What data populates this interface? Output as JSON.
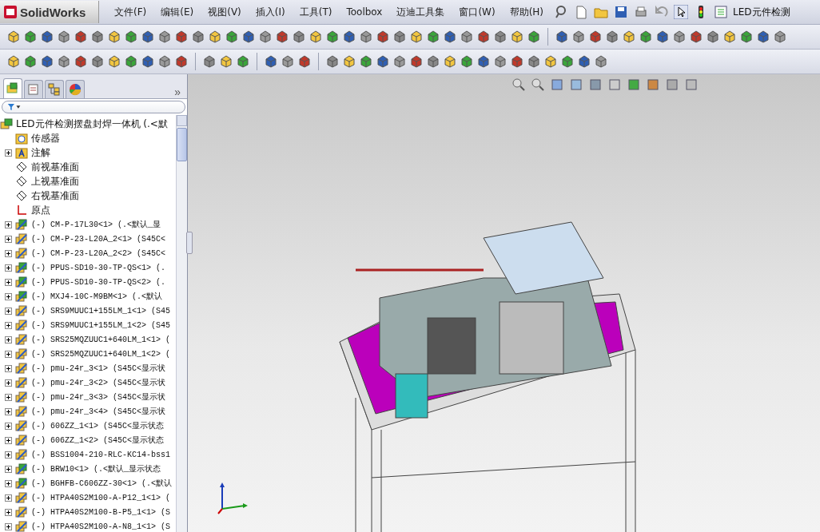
{
  "app": {
    "logo": "SolidWorks",
    "title": "LED元件检测"
  },
  "menu": [
    "文件(F)",
    "编辑(E)",
    "视图(V)",
    "插入(I)",
    "工具(T)",
    "Toolbox",
    "迈迪工具集",
    "窗口(W)",
    "帮助(H)"
  ],
  "panel_tabs": [
    {
      "selected": true
    },
    {
      "selected": false
    },
    {
      "selected": false
    },
    {
      "selected": false
    }
  ],
  "panel_collapse": "»",
  "tree": {
    "root": "LED元件检测摆盘封焊一体机 (.<默",
    "items": [
      {
        "kind": "sensor",
        "label": "传感器",
        "expandable": false
      },
      {
        "kind": "annotation",
        "label": "注解",
        "expandable": true
      },
      {
        "kind": "plane",
        "label": "前视基准面",
        "expandable": false
      },
      {
        "kind": "plane",
        "label": "上视基准面",
        "expandable": false
      },
      {
        "kind": "plane",
        "label": "右视基准面",
        "expandable": false
      },
      {
        "kind": "origin",
        "label": "原点",
        "expandable": false
      },
      {
        "kind": "assembly",
        "label": "(-) CM-P-17L30<1> (.<默认_显",
        "expandable": true
      },
      {
        "kind": "part",
        "label": "(-) CM-P-23-L20A_2<1> (S45C<",
        "expandable": true
      },
      {
        "kind": "part",
        "label": "(-) CM-P-23-L20A_2<2> (S45C<",
        "expandable": true
      },
      {
        "kind": "assembly",
        "label": "(-) PPUS-SD10-30-TP-QS<1> (.",
        "expandable": true
      },
      {
        "kind": "assembly",
        "label": "(-) PPUS-SD10-30-TP-QS<2> (.",
        "expandable": true
      },
      {
        "kind": "assembly",
        "label": "(-) MXJ4-10C-M9BM<1> (.<默认",
        "expandable": true
      },
      {
        "kind": "part",
        "label": "(-) SRS9MUUC1+155LM_1<1> (S45",
        "expandable": true
      },
      {
        "kind": "part",
        "label": "(-) SRS9MUUC1+155LM_1<2> (S45",
        "expandable": true
      },
      {
        "kind": "part",
        "label": "(-) SRS25MQZUUC1+640LM_1<1> (",
        "expandable": true
      },
      {
        "kind": "part",
        "label": "(-) SRS25MQZUUC1+640LM_1<2> (",
        "expandable": true
      },
      {
        "kind": "part",
        "label": "(-) pmu-24r_3<1> (S45C<显示状",
        "expandable": true
      },
      {
        "kind": "part",
        "label": "(-) pmu-24r_3<2> (S45C<显示状",
        "expandable": true
      },
      {
        "kind": "part",
        "label": "(-) pmu-24r_3<3> (S45C<显示状",
        "expandable": true
      },
      {
        "kind": "part",
        "label": "(-) pmu-24r_3<4> (S45C<显示状",
        "expandable": true
      },
      {
        "kind": "part",
        "label": "(-) 606ZZ_1<1> (S45C<显示状态",
        "expandable": true
      },
      {
        "kind": "part",
        "label": "(-) 606ZZ_1<2> (S45C<显示状态",
        "expandable": true
      },
      {
        "kind": "part",
        "label": "(-) BSS1004-210-RLC-KC14-bss1",
        "expandable": true
      },
      {
        "kind": "assembly",
        "label": "(-) BRW10<1> (.<默认_显示状态",
        "expandable": true
      },
      {
        "kind": "assembly",
        "label": "(-) BGHFB-C606ZZ-30<1> (.<默认",
        "expandable": true
      },
      {
        "kind": "part",
        "label": "(-) HTPA40S2M100-A-P12_1<1> (",
        "expandable": true
      },
      {
        "kind": "part",
        "label": "(-) HTPA40S2M100-B-P5_1<1> (S",
        "expandable": true
      },
      {
        "kind": "part",
        "label": "(-) HTPA40S2M100-A-N8_1<1> (S",
        "expandable": true
      }
    ]
  }
}
